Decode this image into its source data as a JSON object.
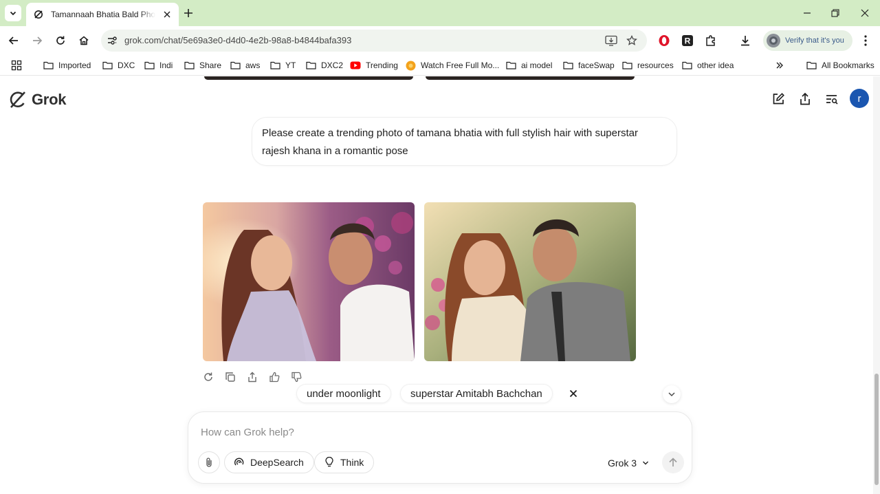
{
  "browser": {
    "tab_title": "Tamannaah Bhatia Bald Photo T",
    "url": "grok.com/chat/5e69a3e0-d4d0-4e2b-98a8-b4844bafa393",
    "profile_chip": "Verify that it's you",
    "bookmarks": [
      "Imported",
      "DXC",
      "Indi",
      "Share",
      "aws",
      "YT",
      "DXC2",
      "Trending",
      "Watch Free Full Mo...",
      "ai model",
      "faceSwap",
      "resources",
      "other idea"
    ],
    "all_bookmarks": "All Bookmarks",
    "accent_color": "#d3ecc5"
  },
  "grok": {
    "logo_text": "Grok",
    "user_initial": "r",
    "user_message": "Please create a trending photo of tamana bhatia with full stylish hair with superstar rajesh khana in a romantic pose",
    "suggestions": [
      "under moonlight",
      "superstar Amitabh Bachchan"
    ],
    "composer": {
      "placeholder": "How can Grok help?",
      "deepsearch_label": "DeepSearch",
      "think_label": "Think",
      "model_label": "Grok 3"
    }
  }
}
